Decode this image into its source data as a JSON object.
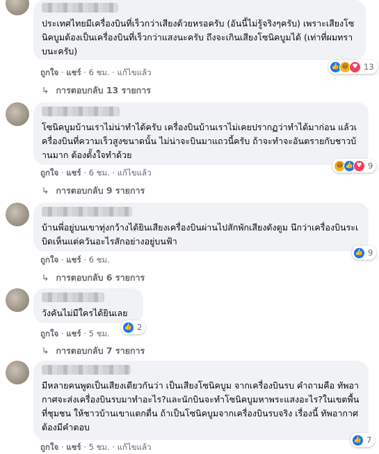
{
  "comments": [
    {
      "text": "ประเทศไทยมีเครื่องบินที่เร็วกว่าเสียงด้วยหรอครับ (อันนี้ไม่รู้จริงๆครับ) เพราะเสียงโซนิคบูมต้องเป็นเครื่องบินที่เร็วกว่าแสงนะครับ ถึงจะเกินเสียงโซนิคบูมได้ (เท่าที่ผมทราบนะครับ)",
      "like_label": "ถูกใจ",
      "share_label": "แชร์",
      "time": "6 ชม.",
      "edited_label": "แก้ไขแล้ว",
      "reactions": [
        "like-icon",
        "haha-icon",
        "love-icon"
      ],
      "reaction_count": "13",
      "replies_label": "การตอบกลับ 13 รายการ"
    },
    {
      "text": "โซนิคบูมบ้านเราไม่น่าทำได้ครับ เครื่องบินบ้านเราไม่เคยปรากฏว่าทำได้มาก่อน แล้วเครื่องบินที่ความเร็วสูงขนาดนั้น ไม่น่าจะบินมาแถวนี้ครับ ถ้าจะทำจะอันตรายกับชาวบ้านมาก ต้องตั้งใจทำด้วย",
      "like_label": "ถูกใจ",
      "share_label": "แชร์",
      "time": "6 ชม.",
      "edited_label": "แก้ไขแล้ว",
      "reactions": [
        "haha-icon",
        "like-icon",
        "love-icon"
      ],
      "reaction_count": "9",
      "replies_label": "การตอบกลับ 9 รายการ"
    },
    {
      "text": "บ้านพี่อยู่บนเขาทุ่งกว้างได้ยินเสียงเครื่องบินผ่านไปสักพักเสียงดังตูม นึกว่าเครื่องบินระเบิดเห็นแต่ควันอะไรสักอย่างอยู่บนฟ้า",
      "like_label": "ถูกใจ",
      "share_label": "แชร์",
      "time": "6 ชม.",
      "edited_label": "",
      "reactions": [
        "like-icon"
      ],
      "reaction_count": "9",
      "replies_label": "การตอบกลับ 6 รายการ"
    },
    {
      "text": "วังคันไม่มีใครได้ยินเลย",
      "like_label": "ถูกใจ",
      "share_label": "แชร์",
      "time": "5 ชม.",
      "edited_label": "",
      "reactions": [
        "like-icon"
      ],
      "reaction_count": "2",
      "replies_label": "การตอบกลับ 7 รายการ"
    },
    {
      "text": "มีหลายคนพูดเป็นเสียงเดียวกันว่า เป็นเสียงโซนิคบูม จากเครื่องบินรบ คำถามคือ ทัพอากาศจะส่งเครื่องบินรบมาทำอะไร?และนักบินจะทำโซนิคบูมหาพระแสงอะไร?ในเขตพื้นที่ชุมชน ให้ชาวบ้านเขาแตกตื่น ถ้าเป็นโซนิคบูมจากเครื่องบินรบจริง เรื่องนี้ ทัพอากาศต้องมีคำตอบ",
      "like_label": "ถูกใจ",
      "share_label": "แชร์",
      "time": "5 ชม.",
      "edited_label": "แก้ไขแล้ว",
      "reactions": [
        "like-icon"
      ],
      "reaction_count": "7",
      "replies_label": ""
    }
  ],
  "colors": {
    "bubble": "#f0f2f5",
    "meta": "#65676b",
    "like": "#1877f2",
    "love": "#f33e58",
    "haha": "#f7b125"
  }
}
